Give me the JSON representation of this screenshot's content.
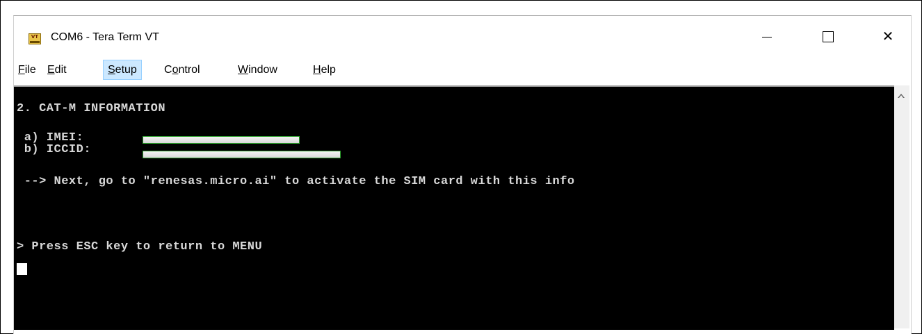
{
  "window": {
    "app_icon_text": "VT",
    "title": "COM6 - Tera Term VT",
    "controls": {
      "minimize": "minimize",
      "maximize": "maximize",
      "close": "✕"
    }
  },
  "menu": {
    "items": [
      {
        "label": "File",
        "accel": "F",
        "rest": "ile"
      },
      {
        "label": "Edit",
        "accel": "E",
        "rest": "dit"
      },
      {
        "label": "Setup",
        "accel": "S",
        "rest": "etup"
      },
      {
        "label": "Control",
        "pre": "C",
        "accel": "o",
        "rest": "ntrol"
      },
      {
        "label": "Window",
        "accel": "W",
        "rest": "indow"
      },
      {
        "label": "Help",
        "accel": "H",
        "rest": "elp"
      }
    ],
    "highlighted": "Setup"
  },
  "terminal": {
    "lines": {
      "heading": "2. CAT-M INFORMATION",
      "imei_label": " a) IMEI:",
      "iccid_label": " b) ICCID:",
      "next": " --> Next, go to \"renesas.micro.ai\" to activate the SIM card with this info",
      "press": "> Press ESC key to return to MENU"
    },
    "background": "#000000",
    "text_color": "#d8d8d8"
  },
  "icons": [
    "app-icon",
    "minimize-icon",
    "maximize-icon",
    "close-icon",
    "scroll-up-arrow-icon"
  ]
}
